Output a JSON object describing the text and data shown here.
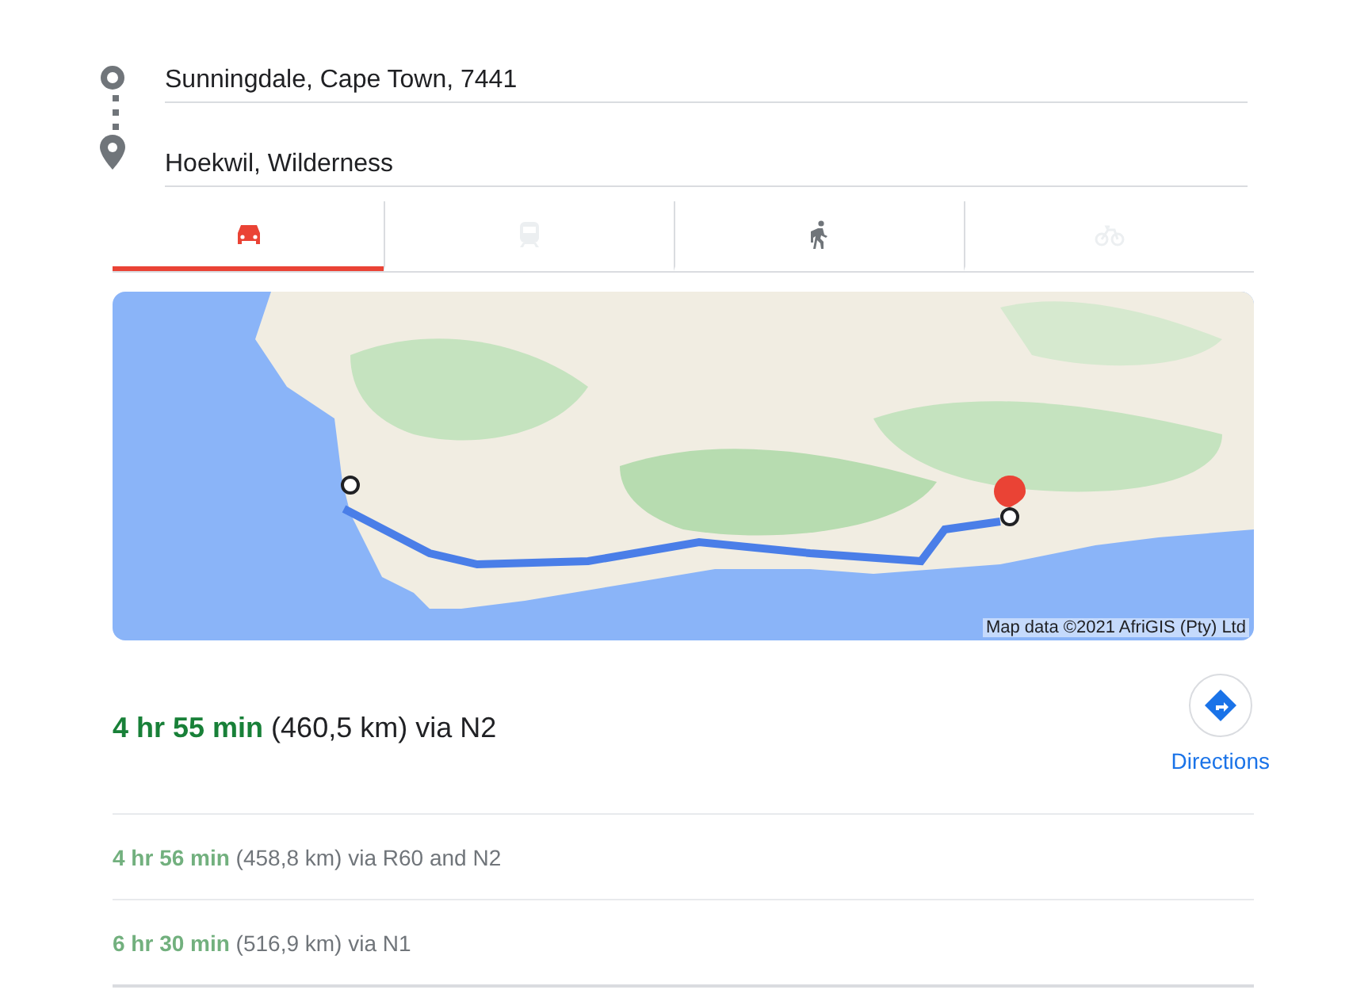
{
  "route_inputs": [
    {
      "kind": "origin",
      "value": "Sunningdale, Cape Town, 7441"
    },
    {
      "kind": "destination",
      "value": "Hoekwil, Wilderness"
    }
  ],
  "modes": [
    {
      "kind": "car",
      "selected": true,
      "disabled": false
    },
    {
      "kind": "transit",
      "selected": false,
      "disabled": true
    },
    {
      "kind": "walk",
      "selected": false,
      "disabled": false
    },
    {
      "kind": "bike",
      "selected": false,
      "disabled": true
    }
  ],
  "map": {
    "kind": "picture",
    "attribution": "Map data ©2021 AfriGIS (Pty) Ltd"
  },
  "best_route": {
    "text": "**4 hr 55 min** (460,5 km) via N2",
    "action": "Directions"
  },
  "alternatives": [
    {
      "text": "**4 hr 56 min** (458,8 km) via R60 and N2"
    },
    {
      "text": "**6 hr 30 min** (516,9 km) via N1"
    }
  ]
}
